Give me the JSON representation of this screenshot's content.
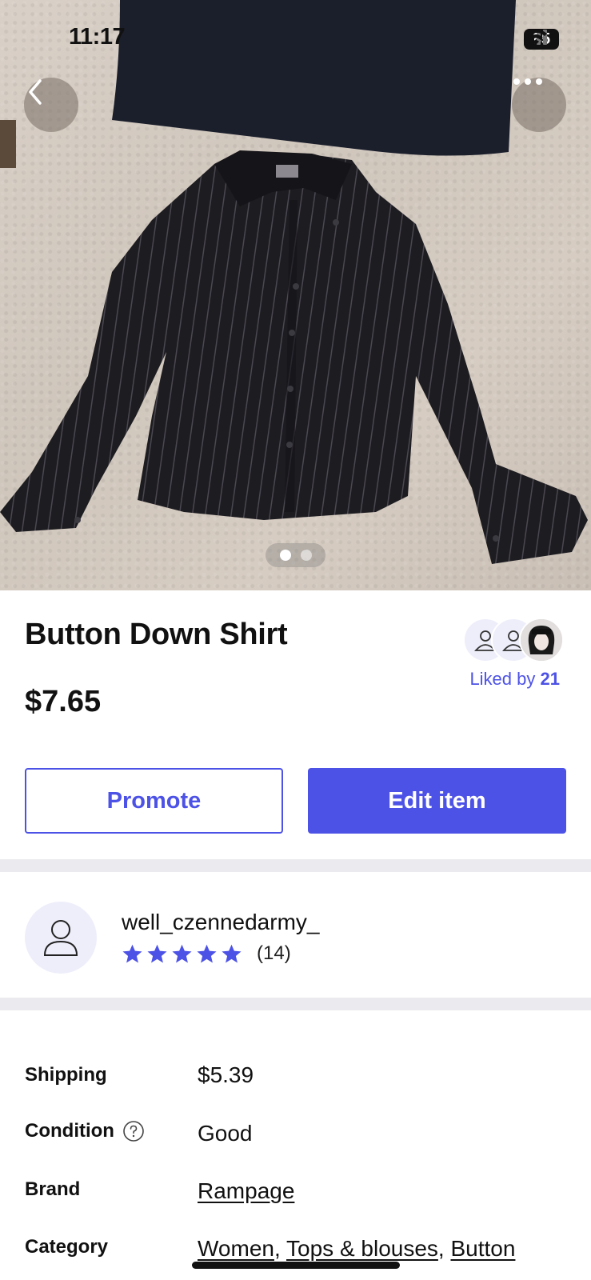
{
  "status_bar": {
    "time": "11:17",
    "battery": "85"
  },
  "photo": {
    "page_count": 2,
    "current_page": 1
  },
  "item": {
    "title": "Button Down Shirt",
    "price": "$7.65"
  },
  "likes": {
    "prefix": "Liked by",
    "count": "21"
  },
  "actions": {
    "promote_label": "Promote",
    "edit_label": "Edit item"
  },
  "seller": {
    "username": "well_czennedarmy_",
    "rating_stars": 5,
    "review_count": "(14)"
  },
  "details": {
    "shipping_label": "Shipping",
    "shipping_value": "$5.39",
    "condition_label": "Condition",
    "condition_value": "Good",
    "brand_label": "Brand",
    "brand_value": "Rampage",
    "category_label": "Category",
    "category_links": [
      "Women",
      "Tops & blouses",
      "Button"
    ]
  },
  "colors": {
    "accent": "#4d52e6",
    "divider": "#ebebef",
    "avatar_bg": "#eeeefb"
  },
  "icons": [
    "back-arrow-icon",
    "more-icon",
    "person-icon",
    "star-icon",
    "help-circle-icon",
    "signal-icon",
    "wifi-icon"
  ]
}
